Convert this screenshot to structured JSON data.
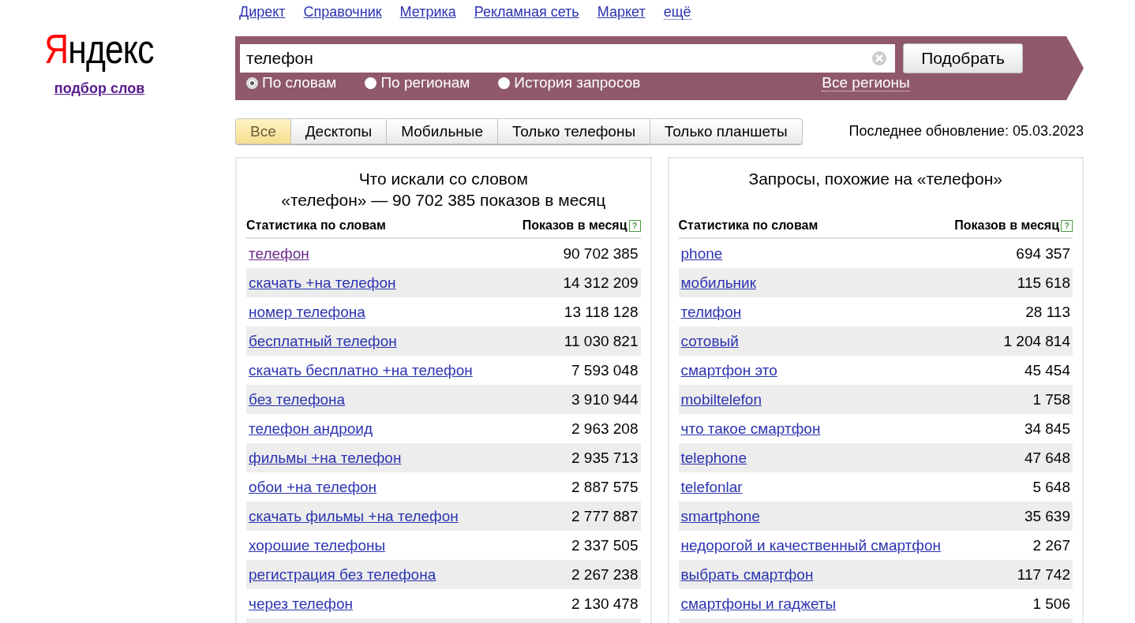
{
  "logo": {
    "accent": "Я",
    "rest": "ндекс",
    "subtitle": "подбор слов"
  },
  "top_links": [
    {
      "label": "Директ",
      "kind": "link"
    },
    {
      "label": "Справочник",
      "kind": "link"
    },
    {
      "label": "Метрика",
      "kind": "link"
    },
    {
      "label": "Рекламная сеть",
      "kind": "link"
    },
    {
      "label": "Маркет",
      "kind": "link"
    },
    {
      "label": "ещё",
      "kind": "dropdown"
    }
  ],
  "search": {
    "value": "телефон",
    "button": "Подобрать",
    "region": "Все регионы",
    "modes": [
      {
        "label": "По словам",
        "selected": true
      },
      {
        "label": "По регионам",
        "selected": false
      },
      {
        "label": "История запросов",
        "selected": false
      }
    ]
  },
  "tabs": [
    {
      "label": "Все",
      "selected": true
    },
    {
      "label": "Десктопы",
      "selected": false
    },
    {
      "label": "Мобильные",
      "selected": false
    },
    {
      "label": "Только телефоны",
      "selected": false
    },
    {
      "label": "Только планшеты",
      "selected": false
    }
  ],
  "last_update": "Последнее обновление: 05.03.2023",
  "panels": [
    {
      "title": "Что искали со словом",
      "subtitle": "«телефон» — 90 702 385 показов в месяц",
      "columns": [
        "Статистика по словам",
        "Показов в месяц"
      ],
      "help": "?",
      "rows": [
        {
          "phrase": "телефон",
          "count": "90 702 385",
          "visited": true
        },
        {
          "phrase": "скачать +на телефон",
          "count": "14 312 209",
          "visited": false
        },
        {
          "phrase": "номер телефона",
          "count": "13 118 128",
          "visited": false
        },
        {
          "phrase": "бесплатный телефон",
          "count": "11 030 821",
          "visited": false
        },
        {
          "phrase": "скачать бесплатно +на телефон",
          "count": "7 593 048",
          "visited": false
        },
        {
          "phrase": "без телефона",
          "count": "3 910 944",
          "visited": false
        },
        {
          "phrase": "телефон андроид",
          "count": "2 963 208",
          "visited": false
        },
        {
          "phrase": "фильмы +на телефон",
          "count": "2 935 713",
          "visited": false
        },
        {
          "phrase": "обои +на телефон",
          "count": "2 887 575",
          "visited": false
        },
        {
          "phrase": "скачать фильмы +на телефон",
          "count": "2 777 887",
          "visited": false
        },
        {
          "phrase": "хорошие телефоны",
          "count": "2 337 505",
          "visited": false
        },
        {
          "phrase": "регистрация без телефона",
          "count": "2 267 238",
          "visited": false
        },
        {
          "phrase": "через телефон",
          "count": "2 130 478",
          "visited": false
        }
      ]
    },
    {
      "title": "Запросы, похожие на «телефон»",
      "columns": [
        "Статистика по словам",
        "Показов в месяц"
      ],
      "help": "?",
      "rows": [
        {
          "phrase": "phone",
          "count": "694 357",
          "visited": false
        },
        {
          "phrase": "мобильник",
          "count": "115 618",
          "visited": false
        },
        {
          "phrase": "телифон",
          "count": "28 113",
          "visited": false
        },
        {
          "phrase": "сотовый",
          "count": "1 204 814",
          "visited": false
        },
        {
          "phrase": "смартфон это",
          "count": "45 454",
          "visited": false
        },
        {
          "phrase": "mobiltelefon",
          "count": "1 758",
          "visited": false
        },
        {
          "phrase": "что такое смартфон",
          "count": "34 845",
          "visited": false
        },
        {
          "phrase": "telephone",
          "count": "47 648",
          "visited": false
        },
        {
          "phrase": "telefonlar",
          "count": "5 648",
          "visited": false
        },
        {
          "phrase": "smartphone",
          "count": "35 639",
          "visited": false
        },
        {
          "phrase": "недорогой и качественный смартфон",
          "count": "2 267",
          "visited": false
        },
        {
          "phrase": "выбрать смартфон",
          "count": "117 742",
          "visited": false
        },
        {
          "phrase": "смартфоны и гаджеты",
          "count": "1 506",
          "visited": false
        }
      ]
    }
  ]
}
